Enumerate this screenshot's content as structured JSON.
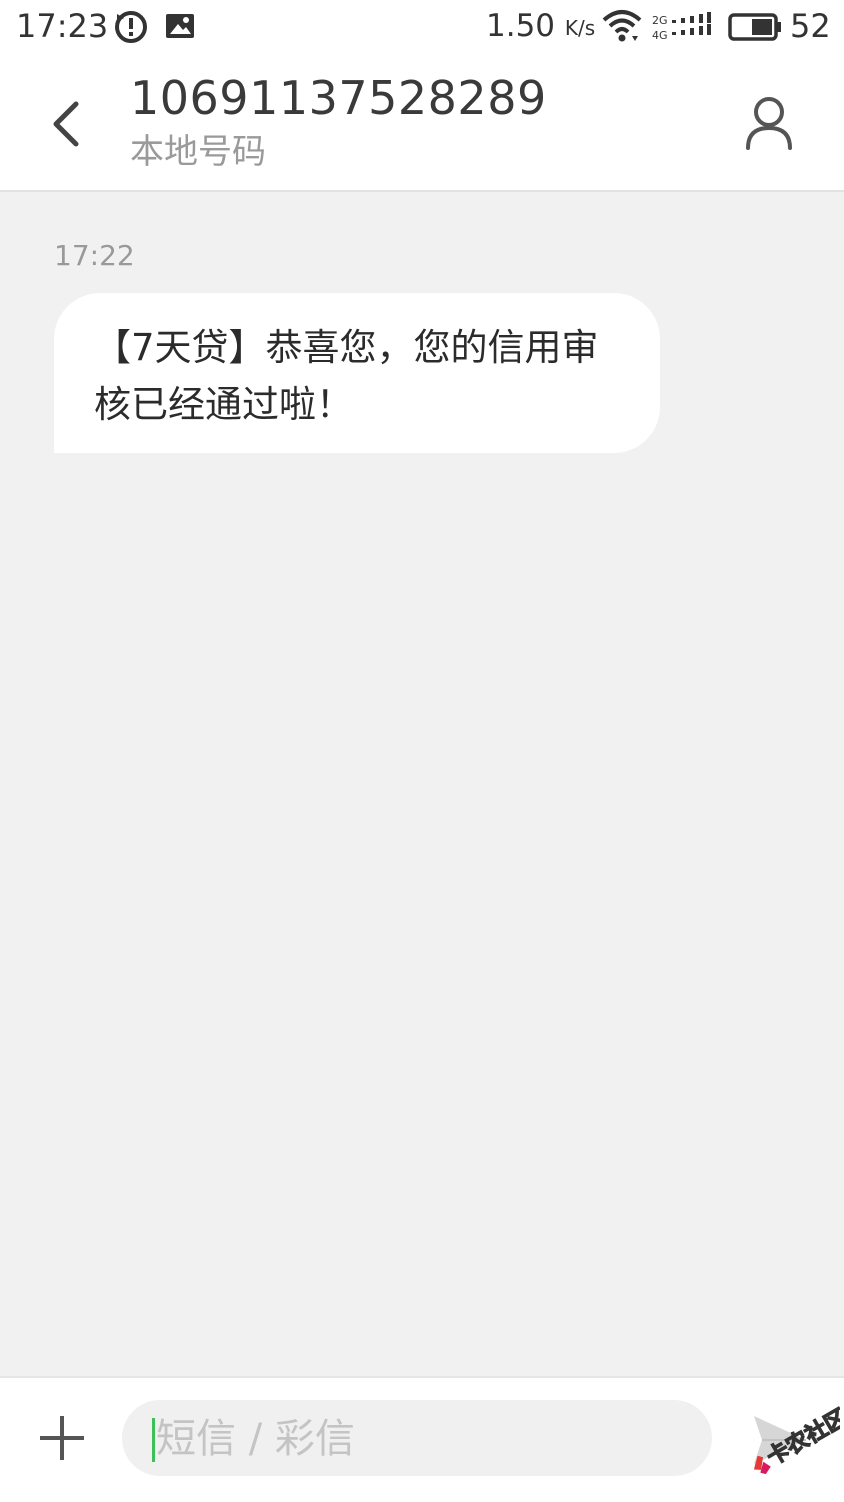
{
  "status_bar": {
    "time": "17:23",
    "net_speed_value": "1.50",
    "net_speed_unit": "K/s",
    "battery_level": "52",
    "icons": [
      "sync-alert-icon",
      "image-notification-icon",
      "wifi-icon",
      "signal-2g-4g-icon",
      "battery-icon"
    ]
  },
  "header": {
    "contact_number": "10691137528289",
    "subtitle": "本地号码",
    "icons": {
      "back": "chevron-left-icon",
      "contact": "person-icon"
    }
  },
  "conversation": {
    "messages": [
      {
        "time": "17:22",
        "text": "【7天贷】恭喜您，您的信用审核已经通过啦！",
        "direction": "incoming"
      }
    ]
  },
  "composer": {
    "placeholder": "短信 / 彩信",
    "value": "",
    "icons": {
      "attach": "plus-icon",
      "send": "send-icon"
    },
    "cursor_color": "#3fbf5a"
  },
  "watermark": {
    "text": "卡农社区"
  },
  "colors": {
    "background": "#f1f1f1",
    "surface": "#ffffff",
    "accent": "#3fbf5a"
  }
}
